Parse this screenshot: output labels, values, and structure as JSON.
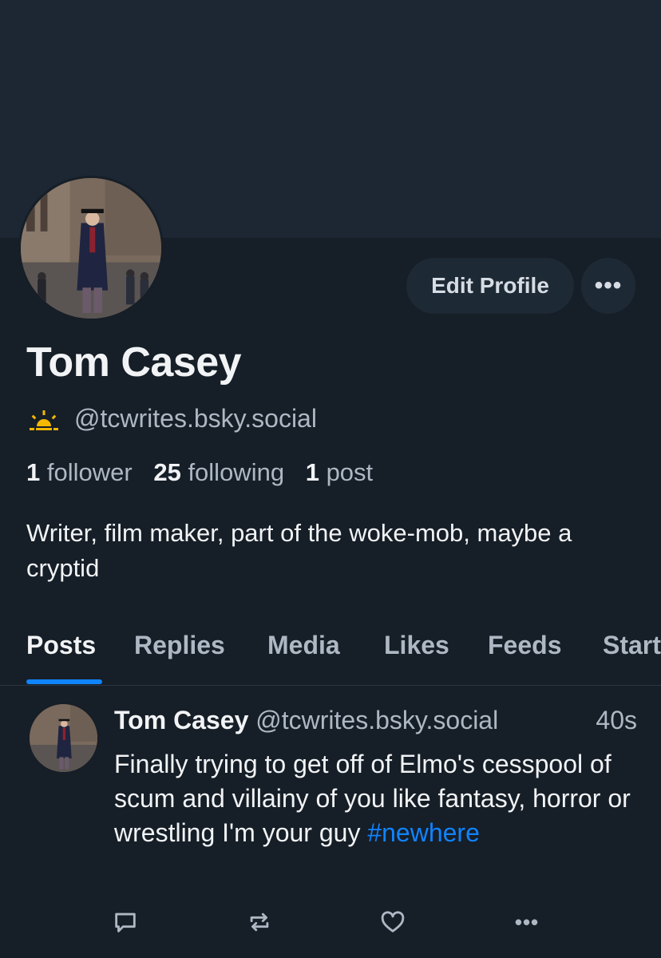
{
  "profile": {
    "name": "Tom Casey",
    "handle": "@tcwrites.bsky.social",
    "edit_label": "Edit Profile",
    "more_label": "•••",
    "bio": "Writer, film maker, part of the woke-mob, maybe a cryptid",
    "stats": {
      "followers_count": "1",
      "followers_label": "follower",
      "following_count": "25",
      "following_label": "following",
      "posts_count": "1",
      "posts_label": "post"
    }
  },
  "tabs": [
    {
      "label": "Posts",
      "active": true
    },
    {
      "label": "Replies"
    },
    {
      "label": "Media"
    },
    {
      "label": "Likes"
    },
    {
      "label": "Feeds"
    },
    {
      "label": "Start"
    }
  ],
  "post": {
    "author": "Tom Casey",
    "handle": "@tcwrites.bsky.social",
    "time": "40s",
    "text": "Finally trying to get off of Elmo's cesspool of scum and villainy of you like fantasy, horror or wrestling I'm your guy",
    "hashtag": "#newhere",
    "more_label": "•••"
  },
  "icons": {
    "new_account_badge": "sunrise-icon",
    "reply": "reply-icon",
    "repost": "repost-icon",
    "like": "heart-icon",
    "more": "more-icon"
  },
  "colors": {
    "background": "#161e27",
    "banner": "#1c2733",
    "accent": "#1083fe",
    "muted_text": "#aeb8c4",
    "badge": "#f5b800"
  }
}
